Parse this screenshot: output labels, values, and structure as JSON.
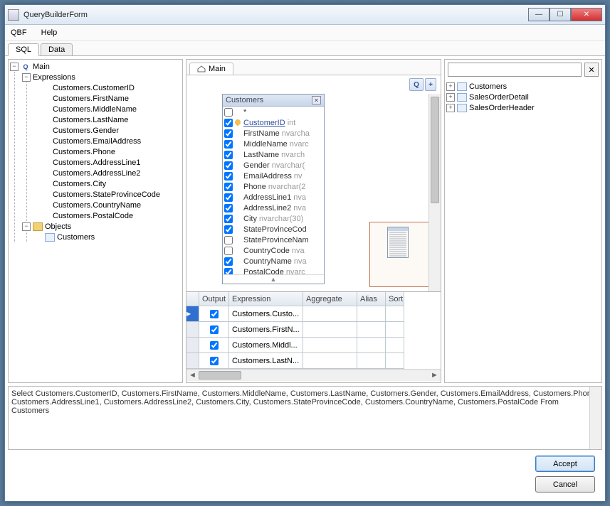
{
  "window": {
    "title": "QueryBuilderForm"
  },
  "menu": {
    "qbf": "QBF",
    "help": "Help"
  },
  "tabs": {
    "sql": "SQL",
    "data": "Data"
  },
  "tree": {
    "root": "Main",
    "expressions": "Expressions",
    "objects": "Objects",
    "objectsChild": "Customers",
    "items": [
      "Customers.CustomerID",
      "Customers.FirstName",
      "Customers.MiddleName",
      "Customers.LastName",
      "Customers.Gender",
      "Customers.EmailAddress",
      "Customers.Phone",
      "Customers.AddressLine1",
      "Customers.AddressLine2",
      "Customers.City",
      "Customers.StateProvinceCode",
      "Customers.CountryName",
      "Customers.PostalCode"
    ]
  },
  "centerTab": "Main",
  "qbtn": "Q",
  "plus": "+",
  "tbox": {
    "title": "Customers",
    "headerRow": "*",
    "more": "▲",
    "cols": [
      {
        "n": "CustomerID",
        "t": "int",
        "c": true,
        "pk": true
      },
      {
        "n": "FirstName",
        "t": "nvarcha",
        "c": true
      },
      {
        "n": "MiddleName",
        "t": "nvarc",
        "c": true
      },
      {
        "n": "LastName",
        "t": "nvarch",
        "c": true
      },
      {
        "n": "Gender",
        "t": "nvarchar(",
        "c": true
      },
      {
        "n": "EmailAddress",
        "t": "nv",
        "c": true
      },
      {
        "n": "Phone",
        "t": "nvarchar(2",
        "c": true
      },
      {
        "n": "AddressLine1",
        "t": "nva",
        "c": true
      },
      {
        "n": "AddressLine2",
        "t": "nva",
        "c": true
      },
      {
        "n": "City",
        "t": "nvarchar(30)",
        "c": true
      },
      {
        "n": "StateProvinceCod",
        "t": "",
        "c": true
      },
      {
        "n": "StateProvinceNam",
        "t": "",
        "c": false
      },
      {
        "n": "CountryCode",
        "t": "nva",
        "c": false
      },
      {
        "n": "CountryName",
        "t": "nva",
        "c": true
      },
      {
        "n": "PostalCode",
        "t": "nvarc",
        "c": true
      }
    ]
  },
  "grid": {
    "headers": {
      "output": "Output",
      "expression": "Expression",
      "aggregate": "Aggregate",
      "alias": "Alias",
      "sort": "Sort"
    },
    "rows": [
      {
        "out": true,
        "expr": "Customers.Custo..."
      },
      {
        "out": true,
        "expr": "Customers.FirstN..."
      },
      {
        "out": true,
        "expr": "Customers.Middl..."
      },
      {
        "out": true,
        "expr": "Customers.LastN..."
      }
    ]
  },
  "right": {
    "items": [
      "Customers",
      "SalesOrderDetail",
      "SalesOrderHeader"
    ]
  },
  "sql": "Select Customers.CustomerID, Customers.FirstName, Customers.MiddleName, Customers.LastName, Customers.Gender, Customers.EmailAddress, Customers.Phone, Customers.AddressLine1, Customers.AddressLine2, Customers.City, Customers.StateProvinceCode, Customers.CountryName, Customers.PostalCode From Customers",
  "buttons": {
    "accept": "Accept",
    "cancel": "Cancel"
  },
  "icons": {
    "x": "✕",
    "min": "—",
    "max": "☐",
    "tri": "▶"
  }
}
